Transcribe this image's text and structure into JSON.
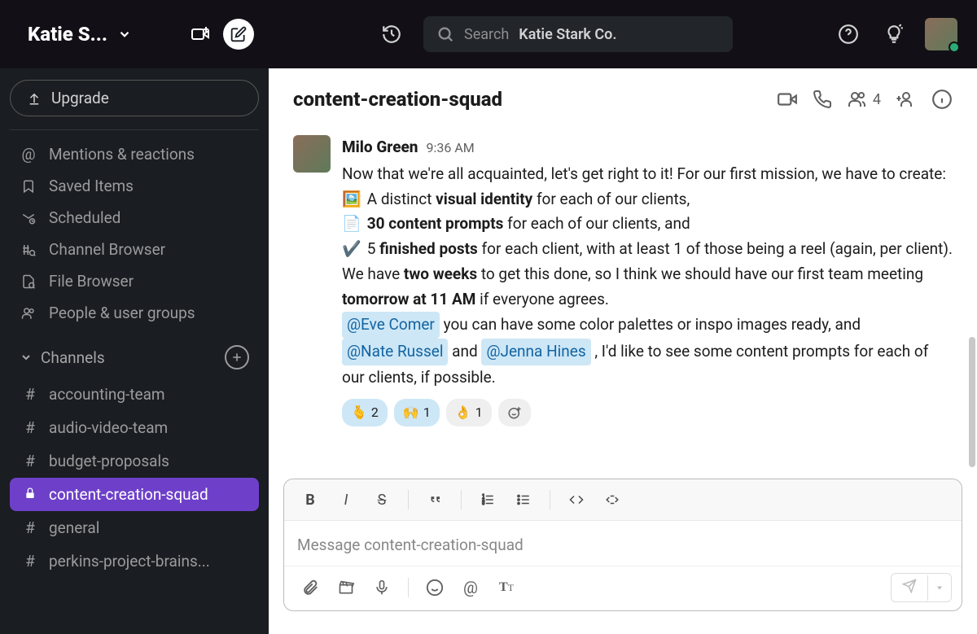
{
  "workspace": {
    "name": "Katie S..."
  },
  "sidebar": {
    "upgrade_label": "Upgrade",
    "nav": [
      {
        "label": "Mentions & reactions",
        "icon": "at"
      },
      {
        "label": "Saved Items",
        "icon": "bookmark"
      },
      {
        "label": "Scheduled",
        "icon": "scheduled"
      },
      {
        "label": "Channel Browser",
        "icon": "channel-browser"
      },
      {
        "label": "File Browser",
        "icon": "file-browser"
      },
      {
        "label": "People & user groups",
        "icon": "people"
      }
    ],
    "channels_label": "Channels",
    "channels": [
      {
        "name": "accounting-team",
        "private": false,
        "active": false
      },
      {
        "name": "audio-video-team",
        "private": false,
        "active": false
      },
      {
        "name": "budget-proposals",
        "private": false,
        "active": false
      },
      {
        "name": "content-creation-squad",
        "private": true,
        "active": true
      },
      {
        "name": "general",
        "private": false,
        "active": false
      },
      {
        "name": "perkins-project-brains...",
        "private": false,
        "active": false
      }
    ]
  },
  "search": {
    "placeholder": "Search",
    "org": "Katie Stark Co."
  },
  "channel_header": {
    "title": "content-creation-squad",
    "members": "4"
  },
  "message": {
    "author": "Milo Green",
    "time": "9:36 AM",
    "line1": "Now that we're all acquainted, let's get right to it! For our first mission, we have to create:",
    "bullet1_emoji": "🖼️",
    "bullet1_pre": " A distinct ",
    "bullet1_bold": "visual identity",
    "bullet1_post": " for each of our clients,",
    "bullet2_emoji": "📄",
    "bullet2_bold": "30 content prompts",
    "bullet2_post": " for each of our clients, and",
    "bullet3_emoji": "✔️",
    "bullet3_pre": " 5 ",
    "bullet3_bold": "finished posts",
    "bullet3_post": " for each client, with at least 1 of those being a reel (again, per client).",
    "line_time_pre": "We have ",
    "line_time_b1": "two weeks",
    "line_time_mid": " to get this done, so I think we should have our first team meeting ",
    "line_time_b2": "tomorrow at 11 AM",
    "line_time_post": " if everyone agrees.",
    "mention1": "@Eve Comer",
    "after_m1": " you can have some color palettes or inspo images ready, and ",
    "mention2": "@Nate Russel",
    "between_m23": " and ",
    "mention3": "@Jenna Hines",
    "after_m3": ", I'd like to see some content prompts for each of our clients, if possible.",
    "reactions": [
      {
        "emoji": "🫰",
        "count": "2",
        "mine": true
      },
      {
        "emoji": "🙌",
        "count": "1",
        "mine": true
      },
      {
        "emoji": "👌",
        "count": "1",
        "mine": false
      }
    ]
  },
  "composer": {
    "placeholder": "Message content-creation-squad"
  }
}
